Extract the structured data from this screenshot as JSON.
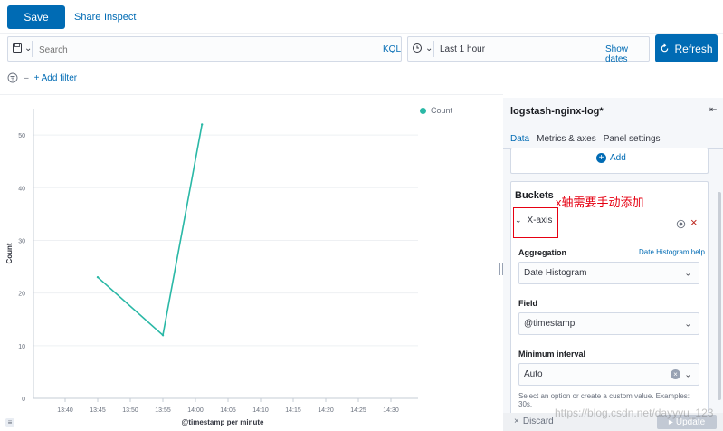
{
  "toolbar": {
    "save_label": "Save",
    "share_label": "Share",
    "inspect_label": "Inspect"
  },
  "query": {
    "search_placeholder": "Search",
    "language_label": "KQL"
  },
  "time": {
    "range_label": "Last 1 hour",
    "show_dates_label": "Show dates",
    "refresh_label": "Refresh"
  },
  "filter": {
    "add_filter_label": "+ Add filter"
  },
  "chart_data": {
    "type": "line",
    "x": [
      "13:45",
      "13:55",
      "14:01"
    ],
    "series": [
      {
        "name": "Count",
        "values": [
          23,
          12,
          52
        ]
      }
    ],
    "x_ticks": [
      "13:40",
      "13:45",
      "13:50",
      "13:55",
      "14:00",
      "14:05",
      "14:10",
      "14:15",
      "14:20",
      "14:25",
      "14:30"
    ],
    "y_ticks": [
      0,
      10,
      20,
      30,
      40,
      50
    ],
    "ylim": [
      0,
      55
    ],
    "xlabel": "@timestamp per minute",
    "ylabel": "Count",
    "legend_position": "top-right",
    "color": "#2ab8a6"
  },
  "sidebar": {
    "index_title": "logstash-nginx-log*",
    "tabs": [
      "Data",
      "Metrics & axes",
      "Panel settings"
    ],
    "add_label": "Add",
    "buckets_title": "Buckets",
    "annotation": "x轴需要手动添加",
    "xaxis_label": "X-axis",
    "aggregation_label": "Aggregation",
    "aggregation_help": "Date Histogram help",
    "aggregation_value": "Date Histogram",
    "field_label": "Field",
    "field_value": "@timestamp",
    "interval_label": "Minimum interval",
    "interval_value": "Auto",
    "interval_help": "Select an option or create a custom value. Examples: 30s,",
    "discard_label": "Discard",
    "update_label": "Update",
    "watermark": "https://blog.csdn.net/dayyyu_123"
  },
  "colors": {
    "primary": "#006bb4",
    "series": "#2ab8a6",
    "danger": "#bd271e",
    "annotation_red": "#e60012"
  }
}
